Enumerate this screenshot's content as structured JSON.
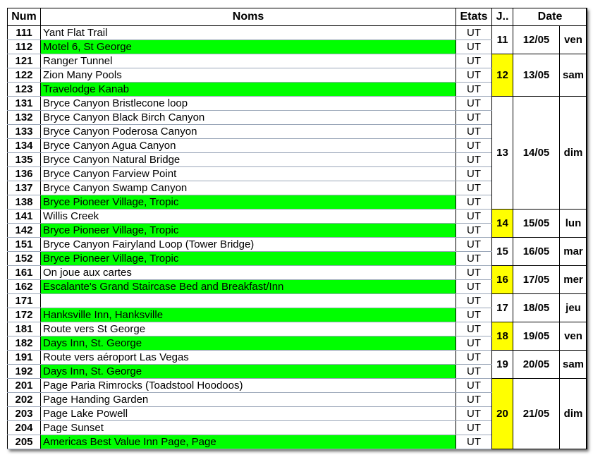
{
  "headers": {
    "num": "Num",
    "noms": "Noms",
    "etats": "Etats",
    "jour": "J..",
    "date": "Date"
  },
  "groups": [
    {
      "jour": "11",
      "date": "12/05",
      "dow": "ven",
      "highlight": false,
      "rows": [
        {
          "num": "111",
          "nom": "Yant Flat Trail",
          "etat": "UT",
          "green": false
        },
        {
          "num": "112",
          "nom": "Motel 6, St George",
          "etat": "UT",
          "green": true
        }
      ]
    },
    {
      "jour": "12",
      "date": "13/05",
      "dow": "sam",
      "highlight": true,
      "rows": [
        {
          "num": "121",
          "nom": "Ranger Tunnel",
          "etat": "UT",
          "green": false
        },
        {
          "num": "122",
          "nom": "Zion Many Pools",
          "etat": "UT",
          "green": false
        },
        {
          "num": "123",
          "nom": "Travelodge Kanab",
          "etat": "UT",
          "green": true
        }
      ]
    },
    {
      "jour": "13",
      "date": "14/05",
      "dow": "dim",
      "highlight": false,
      "rows": [
        {
          "num": "131",
          "nom": "Bryce Canyon Bristlecone loop",
          "etat": "UT",
          "green": false
        },
        {
          "num": "132",
          "nom": "Bryce Canyon Black Birch Canyon",
          "etat": "UT",
          "green": false
        },
        {
          "num": "133",
          "nom": "Bryce Canyon Poderosa Canyon",
          "etat": "UT",
          "green": false
        },
        {
          "num": "134",
          "nom": "Bryce Canyon Agua Canyon",
          "etat": "UT",
          "green": false
        },
        {
          "num": "135",
          "nom": "Bryce Canyon Natural Bridge",
          "etat": "UT",
          "green": false
        },
        {
          "num": "136",
          "nom": "Bryce Canyon Farview Point",
          "etat": "UT",
          "green": false
        },
        {
          "num": "137",
          "nom": "Bryce Canyon Swamp Canyon",
          "etat": "UT",
          "green": false
        },
        {
          "num": "138",
          "nom": "Bryce Pioneer Village, Tropic",
          "etat": "UT",
          "green": true
        }
      ]
    },
    {
      "jour": "14",
      "date": "15/05",
      "dow": "lun",
      "highlight": true,
      "rows": [
        {
          "num": "141",
          "nom": "Willis Creek",
          "etat": "UT",
          "green": false
        },
        {
          "num": "142",
          "nom": "Bryce Pioneer Village, Tropic",
          "etat": "UT",
          "green": true
        }
      ]
    },
    {
      "jour": "15",
      "date": "16/05",
      "dow": "mar",
      "highlight": false,
      "rows": [
        {
          "num": "151",
          "nom": "Bryce Canyon Fairyland Loop (Tower Bridge)",
          "etat": "UT",
          "green": false
        },
        {
          "num": "152",
          "nom": "Bryce Pioneer Village, Tropic",
          "etat": "UT",
          "green": true
        }
      ]
    },
    {
      "jour": "16",
      "date": "17/05",
      "dow": "mer",
      "highlight": true,
      "rows": [
        {
          "num": "161",
          "nom": "On joue aux cartes",
          "etat": "UT",
          "green": false
        },
        {
          "num": "162",
          "nom": "Escalante's Grand Staircase Bed and Breakfast/Inn",
          "etat": "UT",
          "green": true
        }
      ]
    },
    {
      "jour": "17",
      "date": "18/05",
      "dow": "jeu",
      "highlight": false,
      "rows": [
        {
          "num": "171",
          "nom": "",
          "etat": "UT",
          "green": false
        },
        {
          "num": "172",
          "nom": "Hanksville Inn, Hanksville",
          "etat": "UT",
          "green": true
        }
      ]
    },
    {
      "jour": "18",
      "date": "19/05",
      "dow": "ven",
      "highlight": true,
      "rows": [
        {
          "num": "181",
          "nom": "Route vers St George",
          "etat": "UT",
          "green": false
        },
        {
          "num": "182",
          "nom": "Days Inn, St. George",
          "etat": "UT",
          "green": true
        }
      ]
    },
    {
      "jour": "19",
      "date": "20/05",
      "dow": "sam",
      "highlight": false,
      "rows": [
        {
          "num": "191",
          "nom": "Route vers aéroport Las Vegas",
          "etat": "UT",
          "green": false
        },
        {
          "num": "192",
          "nom": "Days Inn, St. George",
          "etat": "UT",
          "green": true
        }
      ]
    },
    {
      "jour": "20",
      "date": "21/05",
      "dow": "dim",
      "highlight": true,
      "rows": [
        {
          "num": "201",
          "nom": "Page Paria Rimrocks (Toadstool Hoodoos)",
          "etat": "UT",
          "green": false
        },
        {
          "num": "202",
          "nom": "Page Handing Garden",
          "etat": "UT",
          "green": false
        },
        {
          "num": "203",
          "nom": "Page Lake Powell",
          "etat": "UT",
          "green": false
        },
        {
          "num": "204",
          "nom": "Page Sunset",
          "etat": "UT",
          "green": false
        },
        {
          "num": "205",
          "nom": "Americas Best Value Inn Page, Page",
          "etat": "UT",
          "green": true
        }
      ]
    }
  ]
}
